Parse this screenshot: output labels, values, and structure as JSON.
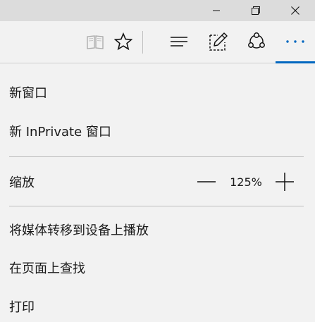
{
  "window": {
    "minimize_icon": "minimize-icon",
    "restore_icon": "restore-icon",
    "close_icon": "close-icon"
  },
  "toolbar": {
    "reading_view_icon": "book-icon",
    "favorites_icon": "star-icon",
    "hub_icon": "hub-lines-icon",
    "web_note_icon": "pen-note-icon",
    "share_icon": "share-icon",
    "more_icon": "ellipsis-icon",
    "more_label": "···",
    "accent_color": "#0067c0"
  },
  "menu": {
    "new_window": "新窗口",
    "new_inprivate_window": "新 InPrivate 窗口",
    "zoom_label": "缩放",
    "zoom_value": "125%",
    "cast_media": "将媒体转移到设备上播放",
    "find_on_page": "在页面上查找",
    "print": "打印"
  }
}
